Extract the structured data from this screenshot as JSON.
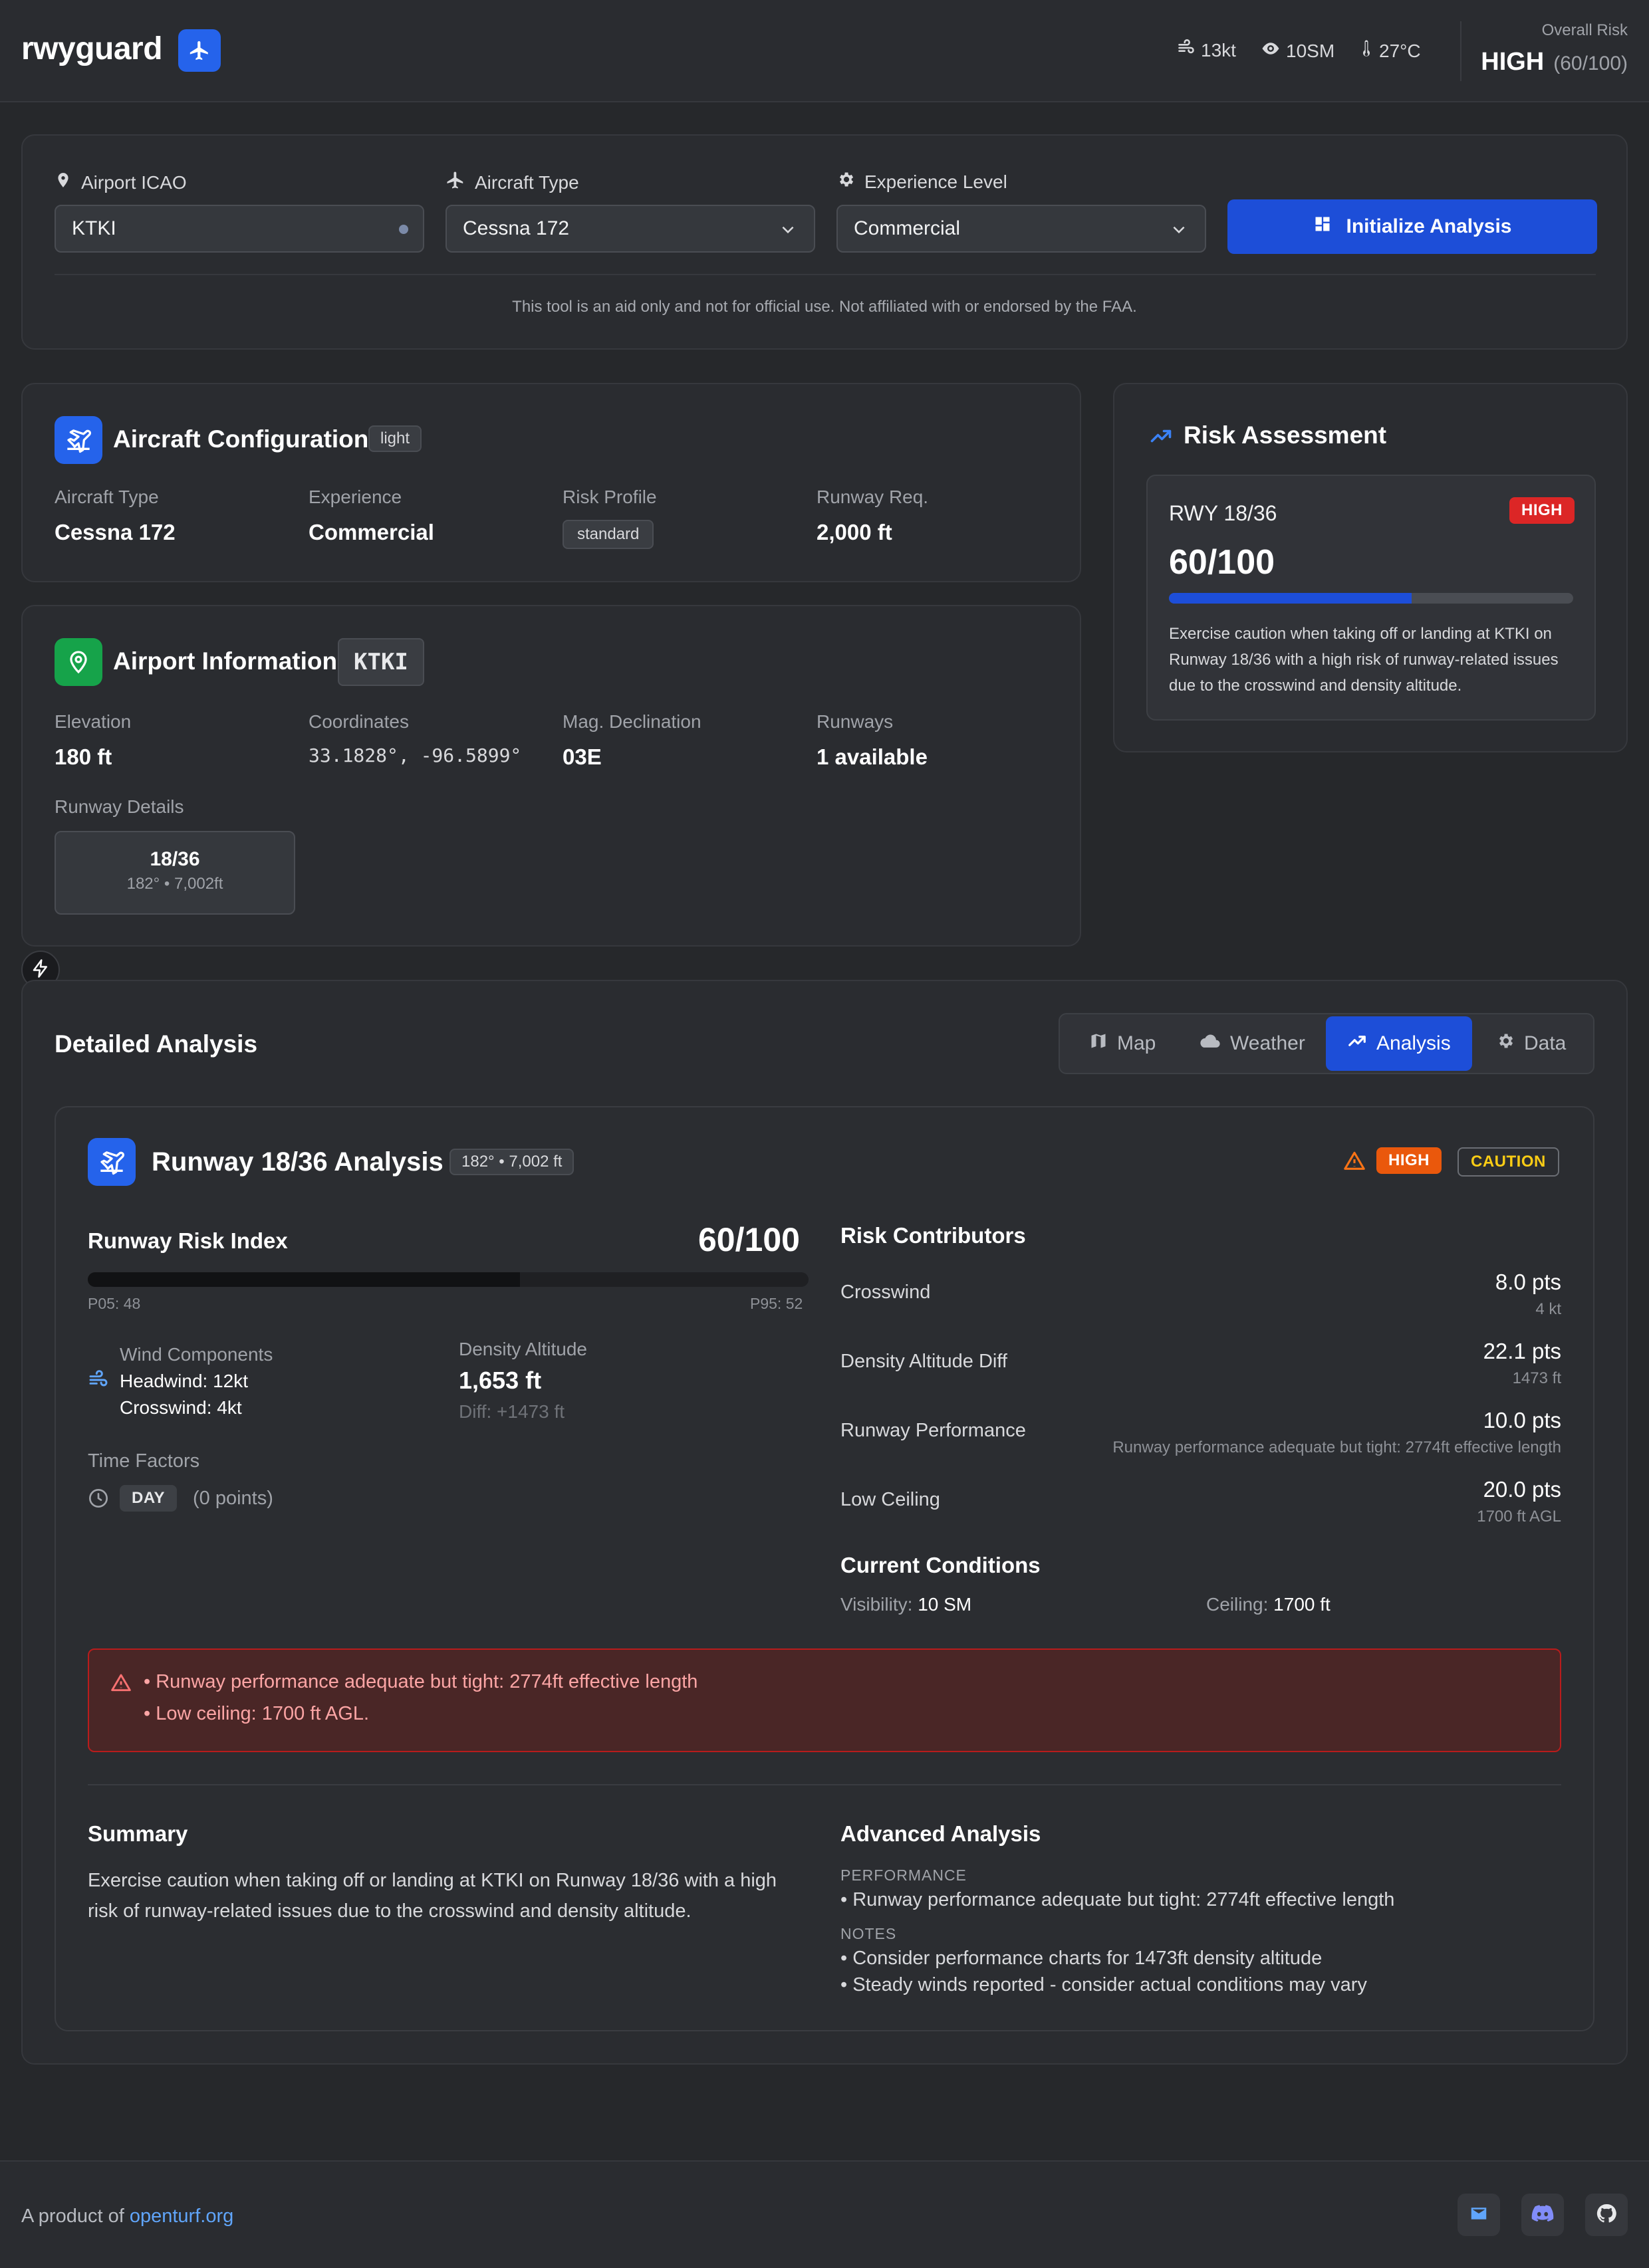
{
  "header": {
    "logo": "rwyguard",
    "wind": "13kt",
    "visibility": "10SM",
    "temperature": "27°C",
    "overall_risk_label": "Overall Risk",
    "overall_risk_level": "HIGH",
    "overall_risk_score": "(60/100)"
  },
  "form": {
    "airport_label": "Airport ICAO",
    "airport_value": "KTKI",
    "aircraft_label": "Aircraft Type",
    "aircraft_value": "Cessna 172",
    "experience_label": "Experience Level",
    "experience_value": "Commercial",
    "submit_label": "Initialize Analysis",
    "disclaimer": "This tool is an aid only and not for official use. Not affiliated with or endorsed by the FAA."
  },
  "aircraft_config": {
    "title": "Aircraft Configuration",
    "class_badge": "light",
    "type_label": "Aircraft Type",
    "type_value": "Cessna 172",
    "experience_label": "Experience",
    "experience_value": "Commercial",
    "risk_profile_label": "Risk Profile",
    "risk_profile_value": "standard",
    "runway_req_label": "Runway Req.",
    "runway_req_value": "2,000 ft"
  },
  "airport_info": {
    "title": "Airport Information",
    "icao": "KTKI",
    "elevation_label": "Elevation",
    "elevation_value": "180 ft",
    "coords_label": "Coordinates",
    "coords_value": "33.1828°, -96.5899°",
    "mag_label": "Mag. Declination",
    "mag_value": "03E",
    "runways_label": "Runways",
    "runways_value": "1 available",
    "runway_details_label": "Runway Details",
    "runway_name": "18/36",
    "runway_meta": "182° • 7,002ft"
  },
  "risk_assessment": {
    "title": "Risk Assessment",
    "runway": "RWY 18/36",
    "level": "HIGH",
    "score": "60/100",
    "score_fraction": 0.6,
    "text": "Exercise caution when taking off or landing at KTKI on Runway 18/36 with a high risk of runway-related issues due to the crosswind and density altitude."
  },
  "detailed": {
    "title": "Detailed Analysis",
    "tabs": [
      {
        "label": "Map",
        "icon": "map-icon"
      },
      {
        "label": "Weather",
        "icon": "cloud-icon"
      },
      {
        "label": "Analysis",
        "icon": "trend-icon",
        "active": true
      },
      {
        "label": "Data",
        "icon": "gear-icon"
      }
    ]
  },
  "runway_analysis": {
    "title": "Runway 18/36 Analysis",
    "meta": "182° • 7,002 ft",
    "badge_high": "HIGH",
    "badge_caution": "CAUTION",
    "risk_index_label": "Runway Risk Index",
    "risk_index_value": "60/100",
    "risk_fraction": 0.6,
    "p05": "P05: 48",
    "p95": "P95: 52",
    "wind_label": "Wind Components",
    "headwind": "Headwind: 12kt",
    "crosswind": "Crosswind: 4kt",
    "density_label": "Density Altitude",
    "density_value": "1,653 ft",
    "density_diff": "Diff: +1473 ft",
    "time_label": "Time Factors",
    "time_badge": "DAY",
    "time_points": "(0 points)",
    "contributors_title": "Risk Contributors",
    "contributors": [
      {
        "name": "Crosswind",
        "pts": "8.0 pts",
        "sub": "4 kt"
      },
      {
        "name": "Density Altitude Diff",
        "pts": "22.1 pts",
        "sub": "1473 ft"
      },
      {
        "name": "Runway Performance",
        "pts": "10.0 pts",
        "sub": "Runway performance adequate but tight: 2774ft effective length"
      },
      {
        "name": "Low Ceiling",
        "pts": "20.0 pts",
        "sub": "1700 ft AGL"
      }
    ],
    "conditions_title": "Current Conditions",
    "visibility_label": "Visibility:",
    "visibility_value": "10 SM",
    "ceiling_label": "Ceiling:",
    "ceiling_value": "1700 ft",
    "warnings": [
      "• Runway performance adequate but tight: 2774ft effective length",
      "• Low ceiling: 1700 ft AGL."
    ],
    "summary_title": "Summary",
    "summary_text": "Exercise caution when taking off or landing at KTKI on Runway 18/36 with a high risk of runway-related issues due to the crosswind and density altitude.",
    "advanced_title": "Advanced Analysis",
    "perf_heading": "PERFORMANCE",
    "perf_items": [
      "• Runway performance adequate but tight: 2774ft effective length"
    ],
    "notes_heading": "NOTES",
    "notes_items": [
      "• Consider performance charts for 1473ft density altitude",
      "• Steady winds reported - consider actual conditions may vary"
    ]
  },
  "footer": {
    "prefix": "A product of",
    "link": "openturf.org"
  },
  "colors": {
    "accent": "#1d4ed8",
    "danger": "#dc2626",
    "warning_orange": "#ea580c",
    "caution_yellow": "#facc15"
  }
}
